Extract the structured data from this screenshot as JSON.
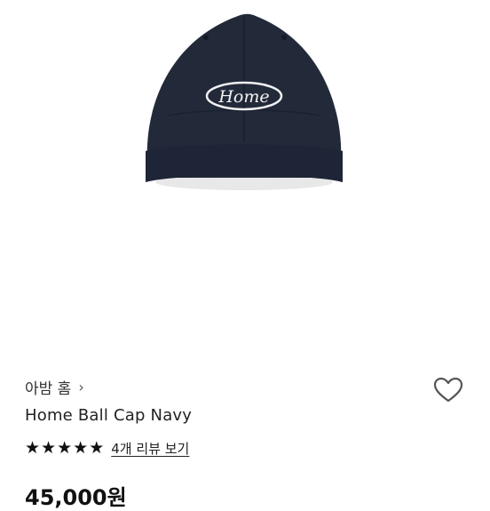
{
  "product": {
    "brand": "아밤 홈",
    "brand_chevron": "›",
    "name": "Home Ball Cap Navy",
    "rating": 5,
    "review_link": "4개 리뷰 보기",
    "price": "45,000원",
    "image_logo_text": "Home"
  },
  "icons": {
    "brand_chevron": "chevron-right-icon",
    "wishlist": "heart-outline-icon",
    "star": "star-icon"
  },
  "colors": {
    "cap": "#222a3a",
    "star": "#111111"
  }
}
